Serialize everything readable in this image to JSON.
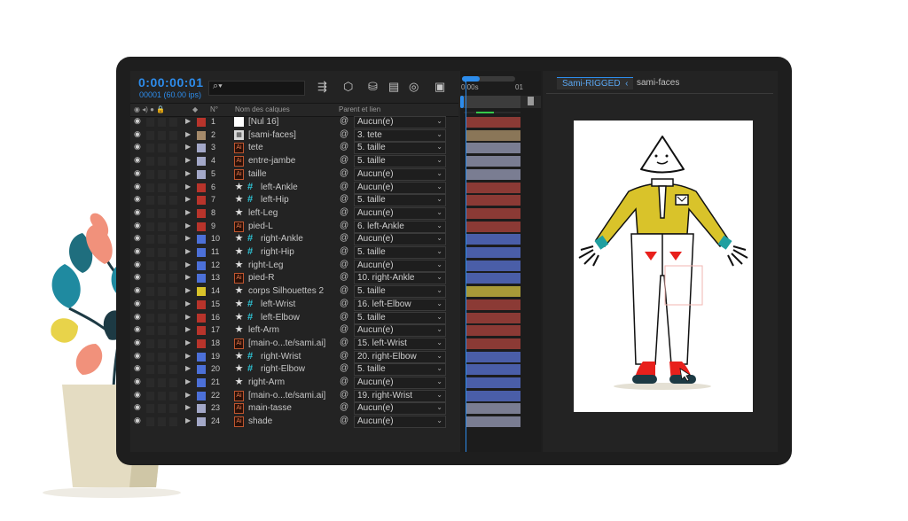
{
  "timecode": "0:00:00:01",
  "frame_info": "00001 (60.00 ips)",
  "search_placeholder": "⌕▾",
  "columns": {
    "num": "N°",
    "name": "Nom des calques",
    "parent": "Parent et lien"
  },
  "timeline": {
    "ruler_start": "0:00s",
    "ruler_end": "01"
  },
  "comp_tabs": {
    "active": "Sami-RIGGED",
    "other": "sami-faces"
  },
  "colors": {
    "accent": "#2d8ceb",
    "red": "#b8342b",
    "tan": "#a58a6a",
    "lavender": "#a3a8c8",
    "blue": "#4c70d8",
    "yellow": "#d9c32a"
  },
  "layers": [
    {
      "num": "1",
      "name": "[Nul 16]",
      "parent": "Aucun(e)",
      "label": "red",
      "icon": "null",
      "hash": false
    },
    {
      "num": "2",
      "name": "[sami-faces]",
      "parent": "3. tete",
      "label": "tan",
      "icon": "comp",
      "hash": false
    },
    {
      "num": "3",
      "name": "tete",
      "parent": "5. taille",
      "label": "lavender",
      "icon": "ai",
      "hash": false
    },
    {
      "num": "4",
      "name": "entre-jambe",
      "parent": "5. taille",
      "label": "lavender",
      "icon": "ai",
      "hash": false
    },
    {
      "num": "5",
      "name": "taille",
      "parent": "Aucun(e)",
      "label": "lavender",
      "icon": "ai",
      "hash": false
    },
    {
      "num": "6",
      "name": "left-Ankle",
      "parent": "Aucun(e)",
      "label": "red",
      "icon": "star",
      "hash": true
    },
    {
      "num": "7",
      "name": "left-Hip",
      "parent": "5. taille",
      "label": "red",
      "icon": "star",
      "hash": true
    },
    {
      "num": "8",
      "name": "left-Leg",
      "parent": "Aucun(e)",
      "label": "red",
      "icon": "star",
      "hash": false
    },
    {
      "num": "9",
      "name": "pied-L",
      "parent": "6. left-Ankle",
      "label": "red",
      "icon": "ai",
      "hash": false
    },
    {
      "num": "10",
      "name": "right-Ankle",
      "parent": "Aucun(e)",
      "label": "blue",
      "icon": "star",
      "hash": true
    },
    {
      "num": "11",
      "name": "right-Hip",
      "parent": "5. taille",
      "label": "blue",
      "icon": "star",
      "hash": true
    },
    {
      "num": "12",
      "name": "right-Leg",
      "parent": "Aucun(e)",
      "label": "blue",
      "icon": "star",
      "hash": false
    },
    {
      "num": "13",
      "name": "pied-R",
      "parent": "10. right-Ankle",
      "label": "blue",
      "icon": "ai",
      "hash": false
    },
    {
      "num": "14",
      "name": "corps Silhouettes 2",
      "parent": "5. taille",
      "label": "yellow",
      "icon": "star",
      "hash": false
    },
    {
      "num": "15",
      "name": "left-Wrist",
      "parent": "16. left-Elbow",
      "label": "red",
      "icon": "star",
      "hash": true
    },
    {
      "num": "16",
      "name": "left-Elbow",
      "parent": "5. taille",
      "label": "red",
      "icon": "star",
      "hash": true
    },
    {
      "num": "17",
      "name": "left-Arm",
      "parent": "Aucun(e)",
      "label": "red",
      "icon": "star",
      "hash": false
    },
    {
      "num": "18",
      "name": "[main-o...te/sami.ai]",
      "parent": "15. left-Wrist",
      "label": "red",
      "icon": "ai",
      "hash": false
    },
    {
      "num": "19",
      "name": "right-Wrist",
      "parent": "20. right-Elbow",
      "label": "blue",
      "icon": "star",
      "hash": true
    },
    {
      "num": "20",
      "name": "right-Elbow",
      "parent": "5. taille",
      "label": "blue",
      "icon": "star",
      "hash": true
    },
    {
      "num": "21",
      "name": "right-Arm",
      "parent": "Aucun(e)",
      "label": "blue",
      "icon": "star",
      "hash": false
    },
    {
      "num": "22",
      "name": "[main-o...te/sami.ai]",
      "parent": "19. right-Wrist",
      "label": "blue",
      "icon": "ai",
      "hash": false
    },
    {
      "num": "23",
      "name": "main-tasse",
      "parent": "Aucun(e)",
      "label": "lavender",
      "icon": "ai",
      "hash": false
    },
    {
      "num": "24",
      "name": "shade",
      "parent": "Aucun(e)",
      "label": "lavender",
      "icon": "ai",
      "hash": false
    }
  ]
}
